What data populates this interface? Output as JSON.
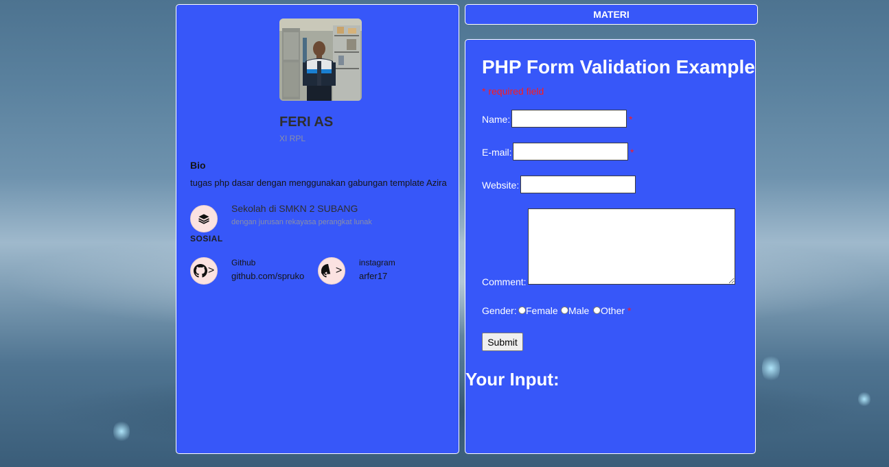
{
  "materi": {
    "label": "MATERI"
  },
  "profile": {
    "name": "FERI AS",
    "class": "XI RPL",
    "bio_title": "Bio",
    "bio_text": "tugas php dasar dengan menggunakan gabungan template Azira",
    "school_title": "Sekolah di SMKN 2 SUBANG",
    "school_sub": "dengan jurusan rekayasa perangkat lunak",
    "sosial_label": "SOSIAL",
    "socials": [
      {
        "label": "Github",
        "value": "github.com/spruko",
        "icon": "github-icon"
      },
      {
        "label": "instagram",
        "value": "arfer17",
        "icon": "github-icon"
      }
    ],
    "arrow": ">"
  },
  "form": {
    "title": "PHP Form Validation Example",
    "required_note": "* required field",
    "star": "*",
    "name_label": "Name:",
    "email_label": "E-mail:",
    "website_label": "Website:",
    "comment_label": "Comment:",
    "gender_label": "Gender:",
    "gender_options": [
      "Female",
      "Male",
      "Other"
    ],
    "name_value": "",
    "email_value": "",
    "website_value": "",
    "comment_value": "",
    "submit_label": "Submit"
  },
  "output": {
    "title": "Your Input:"
  },
  "colors": {
    "card": "#3757f9",
    "required": "#ff1a1a",
    "circle": "#fbe2e1"
  }
}
